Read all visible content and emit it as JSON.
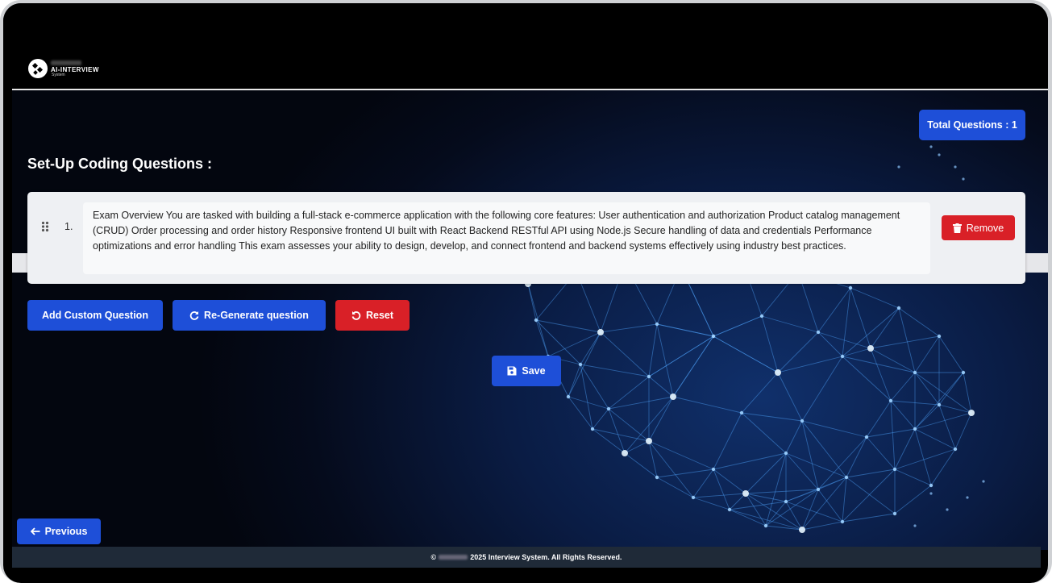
{
  "header": {
    "logo_title": "AI-INTERVIEW",
    "logo_subtitle": "System"
  },
  "badge": {
    "total_questions": "Total Questions : 1"
  },
  "page_title": "Set-Up Coding Questions :",
  "questions": [
    {
      "number": "1.",
      "text": "Exam Overview You are tasked with building a full-stack e-commerce application with the following core features: User authentication and authorization Product catalog management (CRUD) Order processing and order history Responsive frontend UI built with React Backend RESTful API using Node.js Secure handling of data and credentials Performance optimizations and error handling This exam assesses your ability to design, develop, and connect frontend and backend systems effectively using industry best practices.",
      "remove_label": "Remove"
    }
  ],
  "actions": {
    "add_custom": "Add Custom Question",
    "regenerate": "Re-Generate question",
    "reset": "Reset",
    "save": "Save",
    "previous": "Previous"
  },
  "footer": {
    "copyright_symbol": "©",
    "text": "2025 Interview System. All Rights Reserved."
  },
  "colors": {
    "primary": "#1e4fd8",
    "danger": "#d92027",
    "footer_bg": "#1f2a38"
  },
  "icons": [
    "grip-icon",
    "trash-icon",
    "refresh-icon",
    "undo-icon",
    "save-icon",
    "arrow-left-icon"
  ]
}
